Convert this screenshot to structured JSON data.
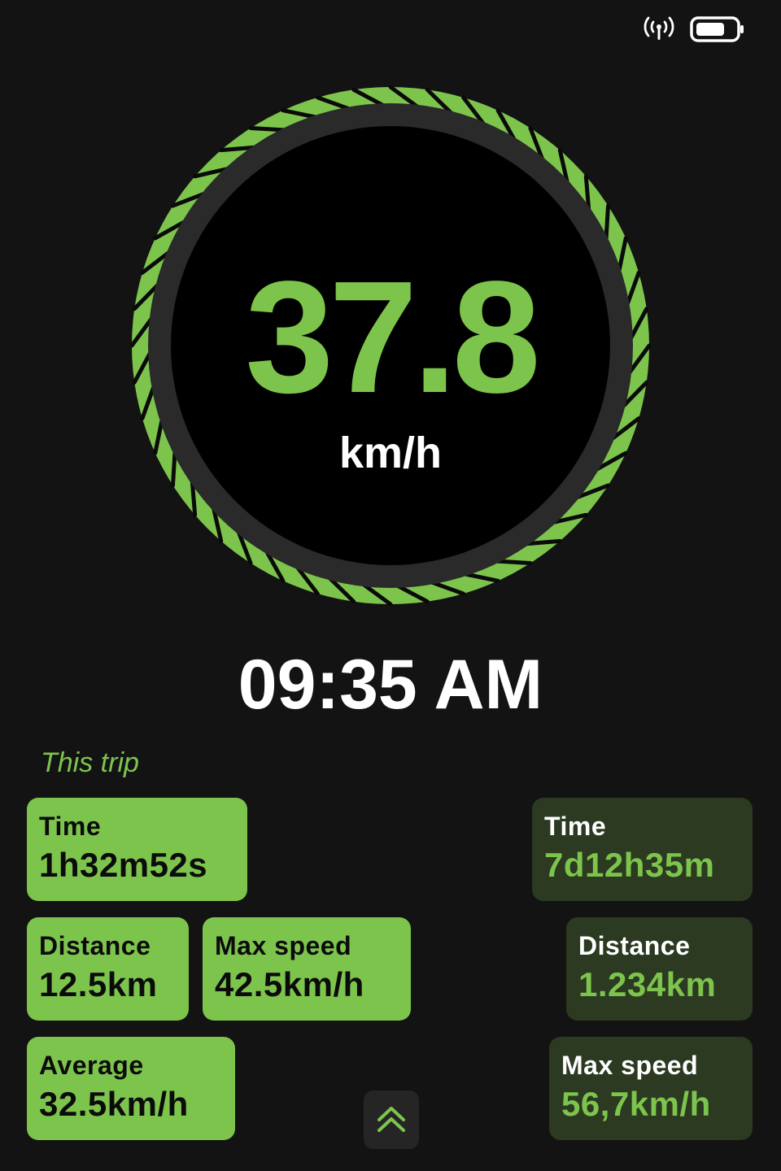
{
  "status": {
    "signal_icon": "signal-icon",
    "battery_icon": "battery-icon"
  },
  "speed": {
    "value": "37.8",
    "unit": "km/h"
  },
  "clock": {
    "time": "09:35 AM"
  },
  "trip": {
    "section_label": "This trip",
    "time": {
      "label": "Time",
      "value": "1h32m52s"
    },
    "distance": {
      "label": "Distance",
      "value": "12.5km"
    },
    "max_speed": {
      "label": "Max speed",
      "value": "42.5km/h"
    },
    "average": {
      "label": "Average",
      "value": "32.5km/h"
    }
  },
  "total": {
    "time": {
      "label": "Time",
      "value": "7d12h35m"
    },
    "distance": {
      "label": "Distance",
      "value": "1.234km"
    },
    "max_speed": {
      "label": "Max speed",
      "value": "56,7km/h"
    }
  },
  "expand_button": {
    "icon": "double-chevron-up-icon"
  },
  "colors": {
    "accent": "#7dc44d",
    "background": "#131313",
    "dark_card": "#2b3a21",
    "dial_ring": "#2a2a2a"
  }
}
